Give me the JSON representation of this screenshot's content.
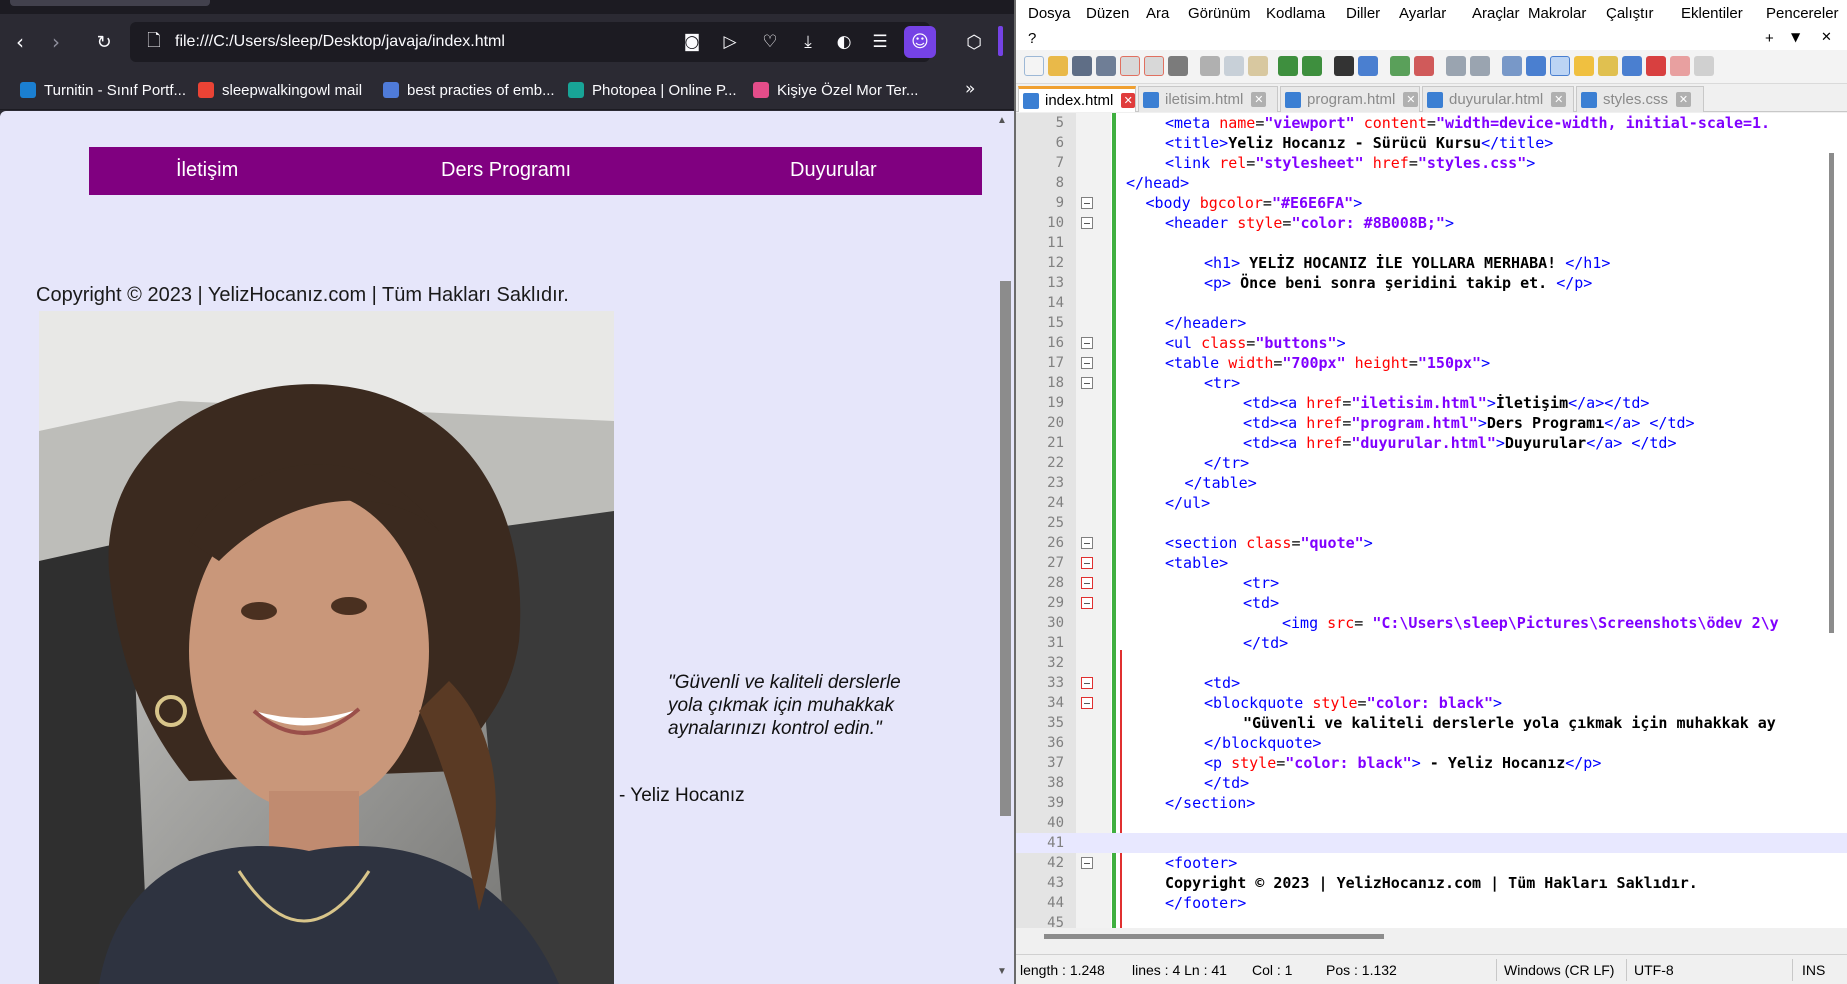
{
  "browser": {
    "url": "file:///C:/Users/sleep/Desktop/javaja/index.html",
    "bookmarks": [
      {
        "label": "Turnitin - Sınıf Portf...",
        "color": "#1b7fd1"
      },
      {
        "label": "sleepwalkingowl mail",
        "color": "#ea4335"
      },
      {
        "label": "best practies of emb...",
        "color": "#4f7bd9"
      },
      {
        "label": "Photopea | Online P...",
        "color": "#18a497"
      },
      {
        "label": "Kişiye Özel Mor Ter...",
        "color": "#e44d8a"
      }
    ]
  },
  "page": {
    "bg_color": "#E6E6FA",
    "nav_color": "#800080",
    "nav": {
      "contact": "İletişim",
      "program": "Ders Programı",
      "announcements": "Duyurular"
    },
    "copyright": "Copyright © 2023 | YelizHocanız.com | Tüm Hakları Saklıdır.",
    "quote": "\"Güvenli ve kaliteli derslerle yola çıkmak için muhakkak aynalarınızı kontrol edin.\"",
    "quote_author": "- Yeliz Hocanız"
  },
  "editor": {
    "menu": [
      "Dosya",
      "Düzen",
      "Ara",
      "Görünüm",
      "Kodlama",
      "Diller",
      "Ayarlar",
      "Araçlar",
      "Makrolar",
      "Çalıştır",
      "Eklentiler",
      "Pencereler"
    ],
    "menu_help": "?",
    "menu_right": [
      "+",
      "▼",
      "✕"
    ],
    "tabs": [
      "index.html",
      "iletisim.html",
      "program.html",
      "duyurular.html",
      "styles.css"
    ],
    "lines": [
      {
        "n": "5",
        "indent": 2,
        "html": "<span class=\"t\">&lt;meta</span> <span class=\"a\">name</span>=<span class=\"v\">\"viewport\"</span> <span class=\"a\">content</span>=<span class=\"v\">\"width=device-width, initial-scale=1.</span>"
      },
      {
        "n": "6",
        "indent": 2,
        "html": "<span class=\"t\">&lt;title&gt;</span><span class=\"x\">Yeliz Hocanız - Sürücü Kursu</span><span class=\"t\">&lt;/title&gt;</span>"
      },
      {
        "n": "7",
        "indent": 2,
        "html": "<span class=\"t\">&lt;link</span> <span class=\"a\">rel</span>=<span class=\"v\">\"stylesheet\"</span> <span class=\"a\">href</span>=<span class=\"v\">\"styles.css\"</span><span class=\"t\">&gt;</span>"
      },
      {
        "n": "8",
        "indent": 0,
        "html": "<span class=\"t\">&lt;/head&gt;</span>"
      },
      {
        "n": "9",
        "indent": 1,
        "fold": true,
        "html": "<span class=\"t\">&lt;body</span> <span class=\"a\">bgcolor</span>=<span class=\"v\">\"#E6E6FA\"</span><span class=\"t\">&gt;</span>"
      },
      {
        "n": "10",
        "indent": 2,
        "fold": true,
        "html": "<span class=\"t\">&lt;header</span> <span class=\"a\">style</span>=<span class=\"v\">\"color: #8B008B;\"</span><span class=\"t\">&gt;</span>"
      },
      {
        "n": "11",
        "indent": 0,
        "html": ""
      },
      {
        "n": "12",
        "indent": 4,
        "html": "<span class=\"t\">&lt;h1&gt;</span> <span class=\"x\">YELİZ HOCANIZ İLE YOLLARA MERHABA!</span> <span class=\"t\">&lt;/h1&gt;</span>"
      },
      {
        "n": "13",
        "indent": 4,
        "html": "<span class=\"t\">&lt;p&gt;</span> <span class=\"x\">Önce beni sonra şeridini takip et.</span> <span class=\"t\">&lt;/p&gt;</span>"
      },
      {
        "n": "14",
        "indent": 0,
        "html": ""
      },
      {
        "n": "15",
        "indent": 2,
        "html": "<span class=\"t\">&lt;/header&gt;</span>"
      },
      {
        "n": "16",
        "indent": 2,
        "fold": true,
        "html": "<span class=\"t\">&lt;ul</span> <span class=\"a\">class</span>=<span class=\"v\">\"buttons\"</span><span class=\"t\">&gt;</span>"
      },
      {
        "n": "17",
        "indent": 2,
        "fold": true,
        "html": "<span class=\"t\">&lt;table</span> <span class=\"a\">width</span>=<span class=\"v\">\"700px\"</span> <span class=\"a\">height</span>=<span class=\"v\">\"150px\"</span><span class=\"t\">&gt;</span>"
      },
      {
        "n": "18",
        "indent": 4,
        "fold": true,
        "html": "<span class=\"t\">&lt;tr&gt;</span>"
      },
      {
        "n": "19",
        "indent": 6,
        "html": "<span class=\"t\">&lt;td&gt;&lt;a</span> <span class=\"a\">href</span>=<span class=\"v\">\"iletisim.html\"</span><span class=\"t\">&gt;</span><span class=\"x\">İletişim</span><span class=\"t\">&lt;/a&gt;&lt;/td&gt;</span>"
      },
      {
        "n": "20",
        "indent": 6,
        "html": "<span class=\"t\">&lt;td&gt;&lt;a</span> <span class=\"a\">href</span>=<span class=\"v\">\"program.html\"</span><span class=\"t\">&gt;</span><span class=\"x\">Ders Programı</span><span class=\"t\">&lt;/a&gt; &lt;/td&gt;</span>"
      },
      {
        "n": "21",
        "indent": 6,
        "html": "<span class=\"t\">&lt;td&gt;&lt;a</span> <span class=\"a\">href</span>=<span class=\"v\">\"duyurular.html\"</span><span class=\"t\">&gt;</span><span class=\"x\">Duyurular</span><span class=\"t\">&lt;/a&gt; &lt;/td&gt;</span>"
      },
      {
        "n": "22",
        "indent": 4,
        "html": "<span class=\"t\">&lt;/tr&gt;</span>"
      },
      {
        "n": "23",
        "indent": 3,
        "html": "<span class=\"t\">&lt;/table&gt;</span>"
      },
      {
        "n": "24",
        "indent": 2,
        "html": "<span class=\"t\">&lt;/ul&gt;</span>"
      },
      {
        "n": "25",
        "indent": 0,
        "html": ""
      },
      {
        "n": "26",
        "indent": 2,
        "fold": true,
        "html": "<span class=\"t\">&lt;section</span> <span class=\"a\">class</span>=<span class=\"v\">\"quote\"</span><span class=\"t\">&gt;</span>"
      },
      {
        "n": "27",
        "indent": 2,
        "fold": true,
        "red": true,
        "html": "<span class=\"t\">&lt;table&gt;</span>"
      },
      {
        "n": "28",
        "indent": 6,
        "fold": true,
        "red": true,
        "html": "<span class=\"t\">&lt;tr&gt;</span>"
      },
      {
        "n": "29",
        "indent": 6,
        "fold": true,
        "red": true,
        "html": "<span class=\"t\">&lt;td&gt;</span>"
      },
      {
        "n": "30",
        "indent": 8,
        "html": "<span class=\"t\">&lt;img</span> <span class=\"a\">src</span>= <span class=\"v\">\"C:\\Users\\sleep\\Pictures\\Screenshots\\ödev 2\\y</span>"
      },
      {
        "n": "31",
        "indent": 6,
        "html": "<span class=\"t\">&lt;/td&gt;</span>"
      },
      {
        "n": "32",
        "indent": 0,
        "html": ""
      },
      {
        "n": "33",
        "indent": 4,
        "fold": true,
        "red": true,
        "html": "<span class=\"t\">&lt;td&gt;</span>"
      },
      {
        "n": "34",
        "indent": 4,
        "fold": true,
        "red": true,
        "html": "<span class=\"t\">&lt;blockquote</span> <span class=\"a\">style</span>=<span class=\"v\">\"color: black\"</span><span class=\"t\">&gt;</span>"
      },
      {
        "n": "35",
        "indent": 6,
        "html": "<span class=\"x\">\"Güvenli ve kaliteli derslerle yola çıkmak için muhakkak ay</span>"
      },
      {
        "n": "36",
        "indent": 4,
        "html": "<span class=\"t\">&lt;/blockquote&gt;</span>"
      },
      {
        "n": "37",
        "indent": 4,
        "html": "<span class=\"t\">&lt;p</span> <span class=\"a\">style</span>=<span class=\"v\">\"color: black\"</span><span class=\"t\">&gt;</span> <span class=\"x\">- Yeliz Hocanız</span><span class=\"t\">&lt;/p&gt;</span>"
      },
      {
        "n": "38",
        "indent": 4,
        "html": "<span class=\"t\">&lt;/td&gt;</span>"
      },
      {
        "n": "39",
        "indent": 2,
        "html": "<span class=\"t\">&lt;/section&gt;</span>"
      },
      {
        "n": "40",
        "indent": 0,
        "html": ""
      },
      {
        "n": "41",
        "indent": 0,
        "cur": true,
        "html": ""
      },
      {
        "n": "42",
        "indent": 2,
        "fold": true,
        "html": "<span class=\"t\">&lt;footer&gt;</span>"
      },
      {
        "n": "43",
        "indent": 2,
        "html": "<span class=\"x\">Copyright © 2023 | YelizHocanız.com | Tüm Hakları Saklıdır.</span>"
      },
      {
        "n": "44",
        "indent": 2,
        "html": "<span class=\"t\">&lt;/footer&gt;</span>"
      },
      {
        "n": "45",
        "indent": 0,
        "html": ""
      }
    ],
    "status": {
      "length": "length : 1.248",
      "lines": "lines : 4 Ln : 41",
      "col": "Col : 1",
      "pos": "Pos : 1.132",
      "eol": "Windows (CR LF)",
      "encoding": "UTF-8",
      "mode": "INS"
    }
  }
}
